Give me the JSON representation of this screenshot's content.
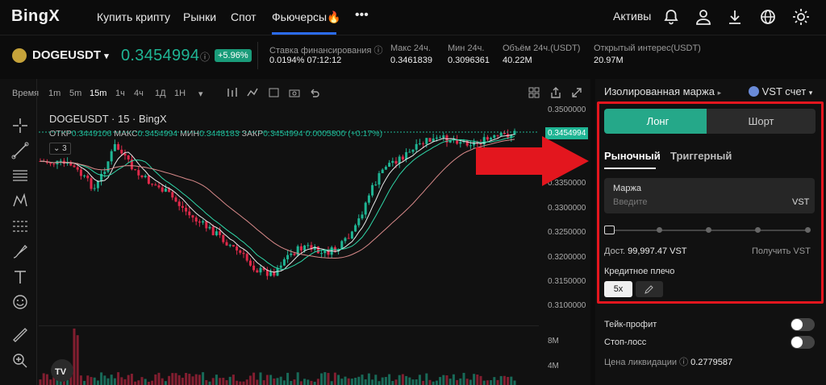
{
  "nav": {
    "logo": "BingX",
    "items": [
      "Купить крипту",
      "Рынки",
      "Спот",
      "Фьючерсы🔥"
    ],
    "more": "•••",
    "assets": "Активы"
  },
  "ticker": {
    "symbol": "DOGEUSDT",
    "dropdown": "▾",
    "price": "0.3454994",
    "info": "ⓘ",
    "change": "+5.96%",
    "stats": [
      {
        "label": "Ставка финансирования ⓘ",
        "value": "0.0194% 07:12:12"
      },
      {
        "label": "Макс 24ч.",
        "value": "0.3461839"
      },
      {
        "label": "Мин 24ч.",
        "value": "0.3096361"
      },
      {
        "label": "Объём 24ч.(USDT)",
        "value": "40.22M"
      },
      {
        "label": "Открытый интерес(USDT)",
        "value": "20.97M"
      }
    ]
  },
  "chart_toolbar": {
    "items": [
      "Время",
      "1m",
      "5m",
      "15m",
      "1ч",
      "4ч",
      "1Д",
      "1Н",
      "▾"
    ]
  },
  "chart": {
    "title": "DOGEUSDT · 15 · BingX",
    "ohlc": [
      {
        "k": "ОТКР",
        "v": "0.3449106"
      },
      {
        "k": "МАКС",
        "v": "0.3454994"
      },
      {
        "k": "МИН",
        "v": "0.3448183"
      },
      {
        "k": "ЗАКР",
        "v": "0.3454994"
      },
      {
        "k": "",
        "v": "0.0005800 (+0.17%)"
      }
    ],
    "indicator_badge": "3",
    "last_price_label": "0.3454994",
    "y_labels": [
      "0.3500000",
      "0.3350000",
      "0.3300000",
      "0.3250000",
      "0.3200000",
      "0.3150000",
      "0.3100000"
    ],
    "volume_labels": [
      "8M",
      "4M"
    ],
    "watermark": "TV"
  },
  "order_panel": {
    "margin_mode": "Изолированная маржа",
    "account": "VST счет",
    "long_tab": "Лонг",
    "short_tab": "Шорт",
    "market": "Рыночный",
    "trigger": "Триггерный",
    "margin_label": "Маржа",
    "margin_placeholder": "Введите",
    "margin_currency": "VST",
    "available_label": "Дост.",
    "available_value": "99,997.47 VST",
    "get_vst": "Получить VST",
    "leverage_label": "Кредитное плечо",
    "leverage_value": "5x",
    "take_profit": "Тейк-профит",
    "stop_loss": "Стоп-лосс",
    "liq_label": "Цена ликвидации",
    "liq_value": "0.2779587"
  },
  "colors": {
    "up": "#1fb594",
    "down": "#e0294a",
    "accent": "#25a889",
    "highlight": "#e3161e"
  }
}
